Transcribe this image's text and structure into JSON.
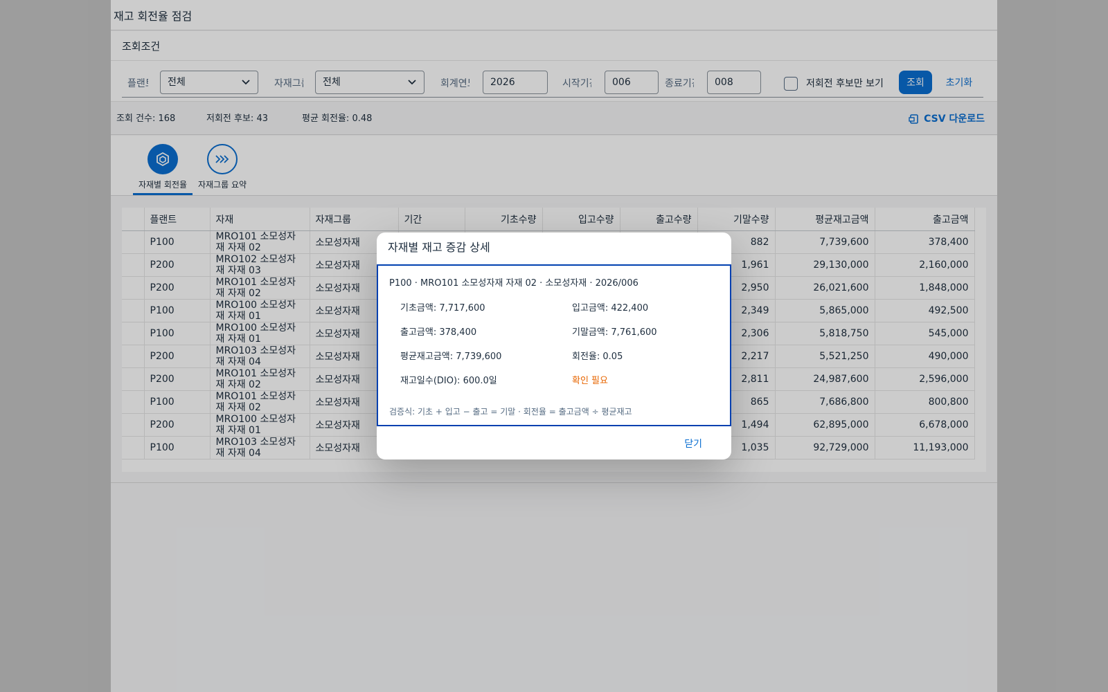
{
  "page": {
    "title": "재고 회전율 점검"
  },
  "filters": {
    "header": "조회조건",
    "plant_label": "플랜트",
    "plant_value": "전체",
    "group_label": "자재그룹",
    "group_value": "전체",
    "year_label": "회계연도",
    "year_value": "2026",
    "start_label": "시작기간",
    "start_value": "006",
    "end_label": "종료기간",
    "end_value": "008",
    "low_only_label": "저회전 후보만 보기",
    "search_button": "조회",
    "reset_button": "초기화"
  },
  "summary": {
    "count": "조회 건수: 168",
    "low_candidates": "저회전 후보: 43",
    "avg_turnover": "평균 회전율: 0.48",
    "csv_button": "CSV 다운로드"
  },
  "tabs": [
    {
      "label": "자재별 회전율",
      "icon": "cube-icon",
      "active": true
    },
    {
      "label": "자재그룹 요약",
      "icon": "chevrons-right-icon",
      "active": false
    }
  ],
  "table": {
    "columns": [
      "플랜트",
      "자재",
      "자재그룹",
      "기간",
      "기초수량",
      "입고수량",
      "출고수량",
      "기말수량",
      "평균재고금액",
      "출고금액"
    ],
    "rows": [
      {
        "plant": "P100",
        "material": "MRO101 소모성자재 자재 02",
        "group": "소모성자재",
        "end_qty": "882",
        "avg_amt": "7,739,600",
        "out_amt": "378,400"
      },
      {
        "plant": "P200",
        "material": "MRO102 소모성자재 자재 03",
        "group": "소모성자재",
        "end_qty": "1,961",
        "avg_amt": "29,130,000",
        "out_amt": "2,160,000"
      },
      {
        "plant": "P200",
        "material": "MRO101 소모성자재 자재 02",
        "group": "소모성자재",
        "end_qty": "2,950",
        "avg_amt": "26,021,600",
        "out_amt": "1,848,000"
      },
      {
        "plant": "P100",
        "material": "MRO100 소모성자재 자재 01",
        "group": "소모성자재",
        "end_qty": "2,349",
        "avg_amt": "5,865,000",
        "out_amt": "492,500"
      },
      {
        "plant": "P100",
        "material": "MRO100 소모성자재 자재 01",
        "group": "소모성자재",
        "end_qty": "2,306",
        "avg_amt": "5,818,750",
        "out_amt": "545,000"
      },
      {
        "plant": "P200",
        "material": "MRO103 소모성자재 자재 04",
        "group": "소모성자재",
        "end_qty": "2,217",
        "avg_amt": "5,521,250",
        "out_amt": "490,000"
      },
      {
        "plant": "P200",
        "material": "MRO101 소모성자재 자재 02",
        "group": "소모성자재",
        "end_qty": "2,811",
        "avg_amt": "24,987,600",
        "out_amt": "2,596,000"
      },
      {
        "plant": "P100",
        "material": "MRO101 소모성자재 자재 02",
        "group": "소모성자재",
        "end_qty": "865",
        "avg_amt": "7,686,800",
        "out_amt": "800,800"
      },
      {
        "plant": "P200",
        "material": "MRO100 소모성자재 자재 01",
        "group": "소모성자재",
        "end_qty": "1,494",
        "avg_amt": "62,895,000",
        "out_amt": "6,678,000"
      },
      {
        "plant": "P100",
        "material": "MRO103 소모성자재 자재 04",
        "group": "소모성자재",
        "end_qty": "1,035",
        "avg_amt": "92,729,000",
        "out_amt": "11,193,000"
      }
    ]
  },
  "dialog": {
    "title": "자재별 재고 증감 상세",
    "header_line": "P100 · MRO101 소모성자재 자재 02 · 소모성자재 · 2026/006",
    "begin_amt": "기초금액: 7,717,600",
    "in_amt": "입고금액: 422,400",
    "out_amt": "출고금액: 378,400",
    "end_amt": "기말금액: 7,761,600",
    "avg_amt": "평균재고금액: 7,739,600",
    "turnover": "회전율: 0.05",
    "dio": "재고일수(DIO): 600.0일",
    "status": "확인 필요",
    "formula": "검증식: 기초 + 입고 − 출고 = 기말 · 회전율 = 출고금액 ÷ 평균재고",
    "close_button": "닫기"
  },
  "colors": {
    "primary": "#0a6ed1",
    "warning": "#e76500",
    "focus_border": "#0040b0"
  }
}
